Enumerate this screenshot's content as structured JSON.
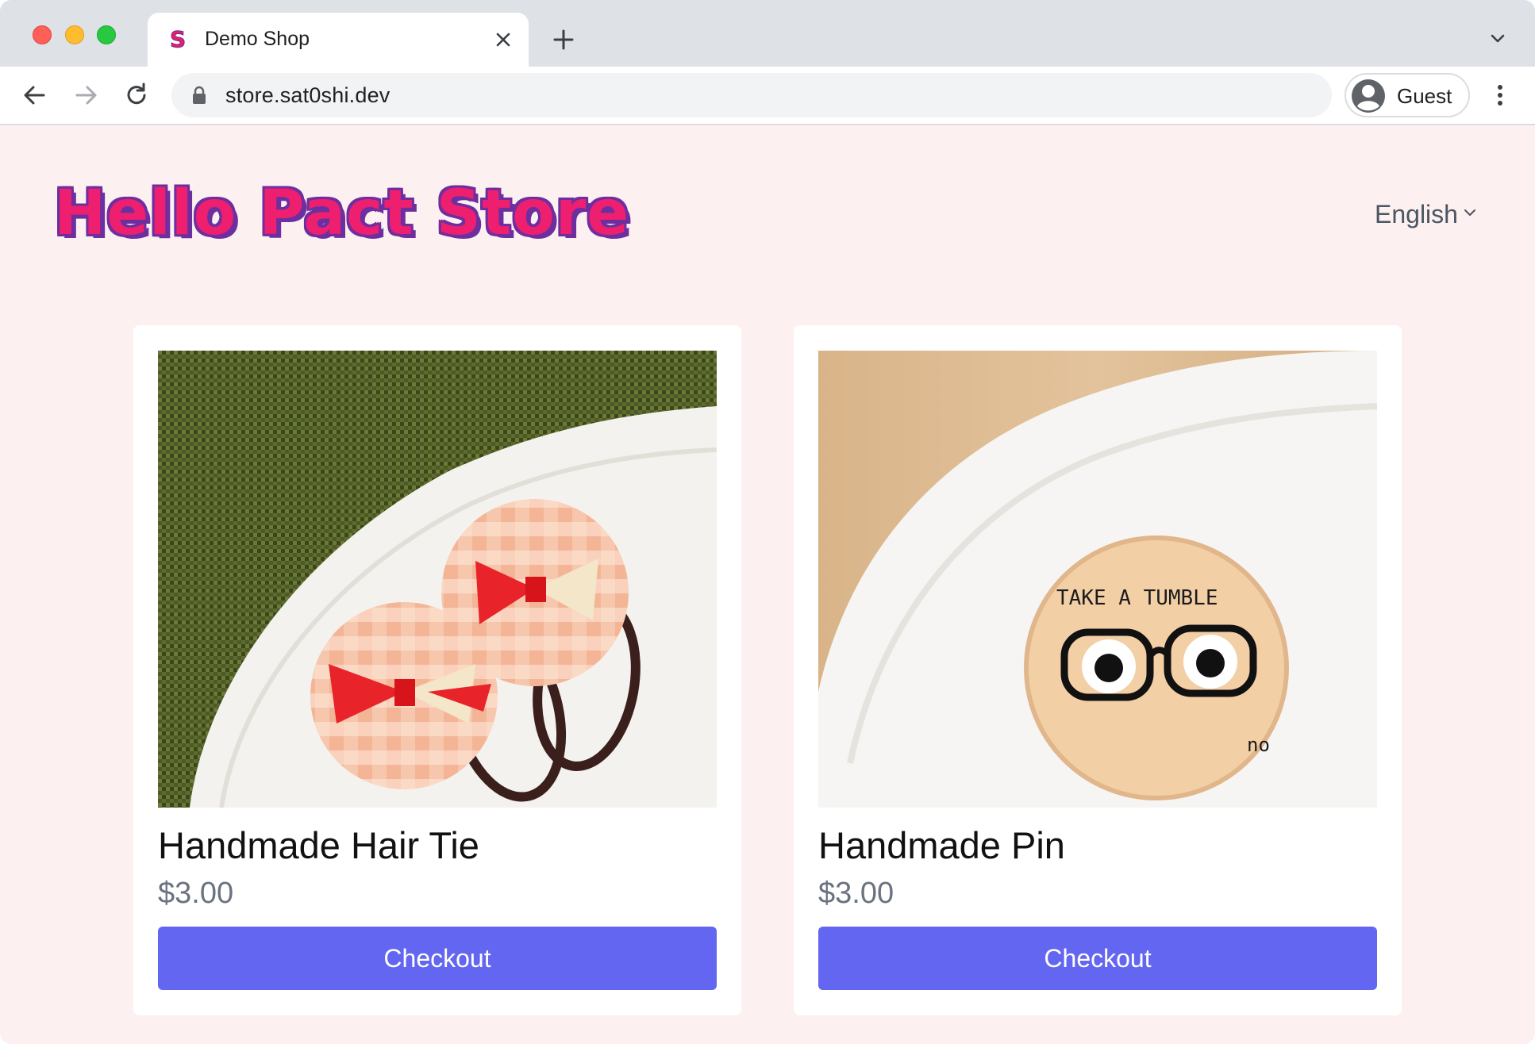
{
  "browser": {
    "tab": {
      "title": "Demo Shop",
      "favicon": "s-logo-icon"
    },
    "address_bar": {
      "url": "store.sat0shi.dev"
    },
    "profile": {
      "name": "Guest"
    },
    "icons": {
      "close": "close-icon",
      "new_tab": "plus-icon",
      "tab_search": "chevron-down-icon",
      "back": "arrow-left-icon",
      "forward": "arrow-right-icon",
      "reload": "reload-icon",
      "lock": "lock-icon",
      "avatar": "account-icon",
      "menu": "more-vertical-icon"
    }
  },
  "store": {
    "title": "Hello Pact Store",
    "language": "English",
    "colors": {
      "title_fill": "#ee1f6f",
      "title_outline": "#6d2fa0",
      "background": "#fdf0f0",
      "button": "#6366f1"
    }
  },
  "products": [
    {
      "name": "Handmade Hair Tie",
      "price": "$3.00",
      "button_label": "Checkout",
      "image": "photo of two peach gingham fabric buttons with red bows on a white plate"
    },
    {
      "name": "Handmade Pin",
      "price": "$3.00",
      "button_label": "Checkout",
      "image": "photo of a fabric button pin with glasses and googly eyes on a white plate"
    }
  ]
}
